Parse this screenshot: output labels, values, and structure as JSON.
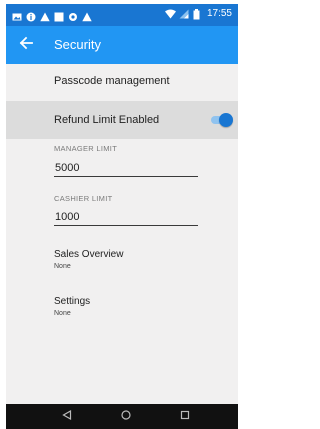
{
  "status_bar": {
    "time": "17:55",
    "left_icons": [
      "image-icon",
      "info-icon",
      "warning-icon",
      "square-icon",
      "gear-icon",
      "warning-icon"
    ],
    "right_icons": [
      "wifi-icon",
      "signal-icon",
      "battery-icon"
    ]
  },
  "app_bar": {
    "title": "Security",
    "back_icon": "arrow-left-icon"
  },
  "settings": {
    "passcode": {
      "label": "Passcode management"
    },
    "refund_limit": {
      "label": "Refund Limit Enabled",
      "enabled": true
    },
    "manager_limit": {
      "label": "MANAGER LIMIT",
      "value": "5000"
    },
    "cashier_limit": {
      "label": "CASHIER LIMIT",
      "value": "1000"
    },
    "sales_overview": {
      "title": "Sales Overview",
      "subtitle": "None"
    },
    "settings_item": {
      "title": "Settings",
      "subtitle": "None"
    }
  },
  "nav_bar": {
    "back_icon": "triangle-back-icon",
    "home_icon": "circle-home-icon",
    "recents_icon": "square-recents-icon"
  },
  "colors": {
    "status_bar": "#1976d2",
    "app_bar": "#2196f3",
    "background": "#f1f0f0",
    "selected_row": "#dcdcdc",
    "accent": "#1976d2",
    "nav_bar": "#111111"
  }
}
